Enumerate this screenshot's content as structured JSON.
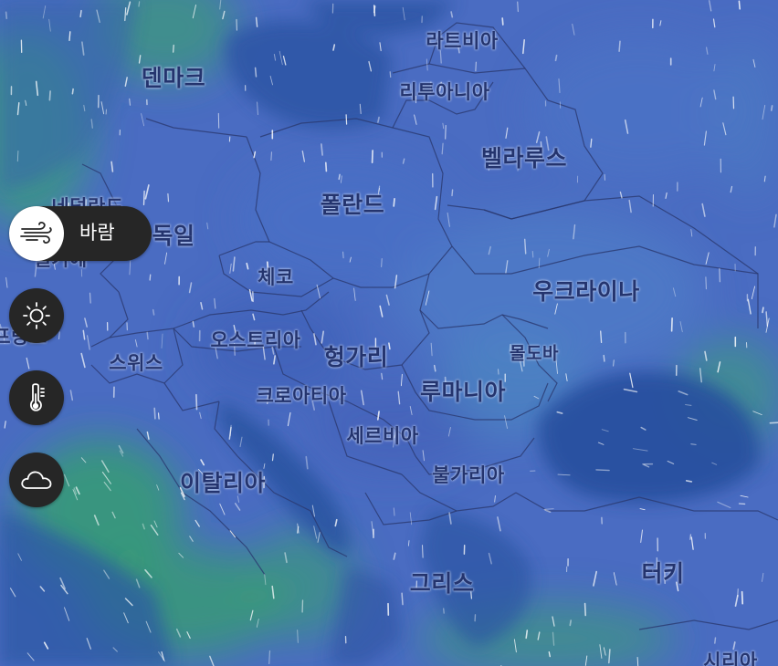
{
  "countries": [
    {
      "id": "denmark",
      "label": "덴마크"
    },
    {
      "id": "latvia",
      "label": "라트비아"
    },
    {
      "id": "lithuania",
      "label": "리투아니아"
    },
    {
      "id": "belarus",
      "label": "벨라루스"
    },
    {
      "id": "netherlands",
      "label": "네덜란드"
    },
    {
      "id": "germany",
      "label": "독일"
    },
    {
      "id": "poland",
      "label": "폴란드"
    },
    {
      "id": "belgium",
      "label": "벨기에"
    },
    {
      "id": "czechia",
      "label": "체코"
    },
    {
      "id": "ukraine",
      "label": "우크라이나"
    },
    {
      "id": "france",
      "label": "프랑스"
    },
    {
      "id": "austria",
      "label": "오스트리아"
    },
    {
      "id": "hungary",
      "label": "헝가리"
    },
    {
      "id": "moldova",
      "label": "몰도바"
    },
    {
      "id": "switzerland",
      "label": "스위스"
    },
    {
      "id": "croatia",
      "label": "크로아티아"
    },
    {
      "id": "romania",
      "label": "루마니아"
    },
    {
      "id": "serbia",
      "label": "세르비아"
    },
    {
      "id": "italy",
      "label": "이탈리아"
    },
    {
      "id": "bulgaria",
      "label": "불가리아"
    },
    {
      "id": "greece",
      "label": "그리스"
    },
    {
      "id": "turkey",
      "label": "터키"
    },
    {
      "id": "syria",
      "label": "시리아"
    }
  ],
  "layers": [
    {
      "id": "wind",
      "label": "바람",
      "icon": "wind-icon",
      "active": true
    },
    {
      "id": "sun",
      "icon": "sun-icon",
      "active": false
    },
    {
      "id": "temperature",
      "icon": "thermometer-icon",
      "active": false
    },
    {
      "id": "cloud",
      "icon": "cloud-icon",
      "active": false
    }
  ],
  "colors": {
    "base": "#4466bb",
    "wind_strong": "#2e9e6e",
    "sea_dark": "#244a96",
    "border": "#2a3a70",
    "label": "#24346e"
  }
}
